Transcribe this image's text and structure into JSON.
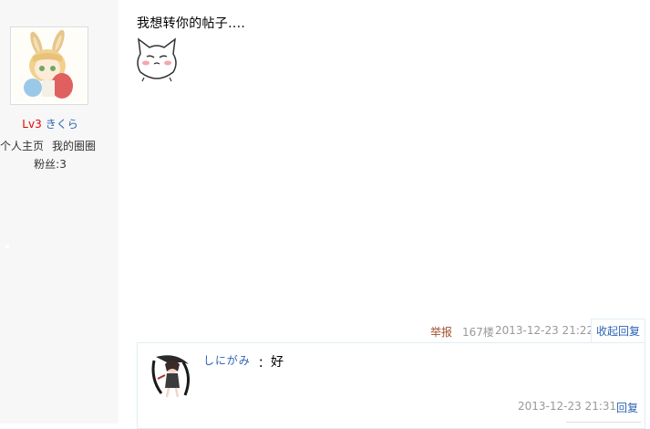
{
  "user": {
    "level": "Lv3",
    "name": "きくら",
    "home_link": "个人主页",
    "circle_link": "我的圈圈",
    "fans": "粉丝:3"
  },
  "post": {
    "text": "我想转你的帖子....",
    "emoji_icon": "cat-blush-emoji-icon"
  },
  "tail": {
    "report": "举报",
    "floor": "167楼",
    "time": "2013-12-23 21:22",
    "collapse_reply": "收起回复"
  },
  "sub_reply": {
    "user": "しにがみ",
    "colon": "：",
    "content": "好",
    "time": "2013-12-23 21:31",
    "reply_label": "回复"
  },
  "colors": {
    "link": "#2d64b3",
    "level": "#e10602",
    "muted": "#999999",
    "sidebar_bg": "#f7f7f7"
  }
}
